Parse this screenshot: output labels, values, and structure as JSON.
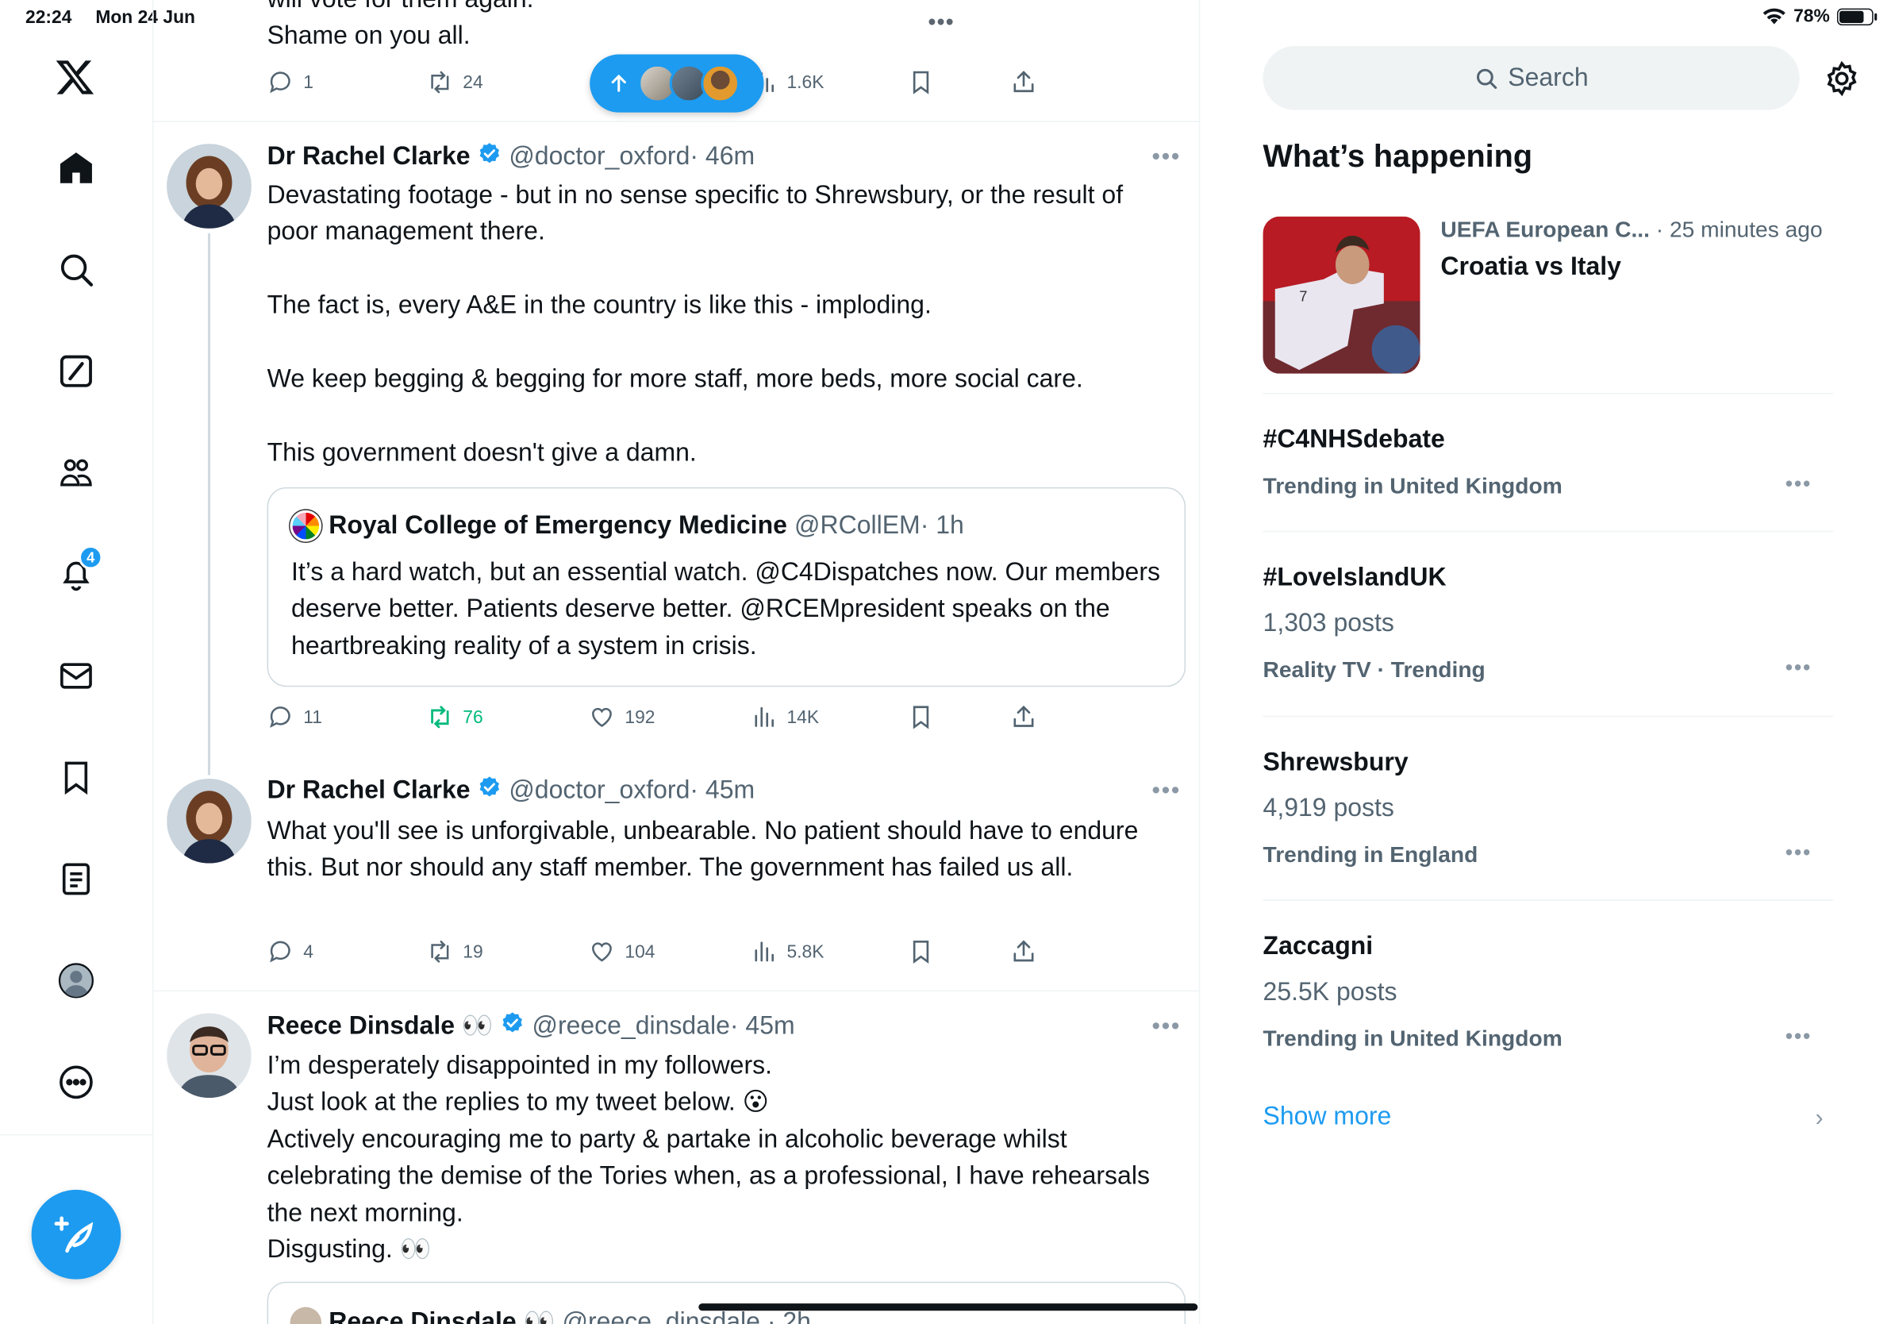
{
  "status_bar": {
    "time": "22:24",
    "date": "Mon 24 Jun",
    "battery": "78%",
    "battery_level": 0.78
  },
  "nav": {
    "items": [
      "x-logo",
      "home",
      "explore",
      "grok",
      "communities",
      "notifications",
      "messages",
      "bookmarks",
      "lists",
      "profile",
      "more"
    ],
    "notifications_badge": "4"
  },
  "feed": {
    "top_tweet": {
      "body_partial": "will vote for them again.\nShame on you all.",
      "replies": "1",
      "reposts": "24",
      "views": "1.6K"
    },
    "tweets": [
      {
        "name": "Dr Rachel Clarke",
        "handle": "@doctor_oxford",
        "time": "· 46m",
        "body": "Devastating footage - but in no sense specific to Shrewsbury, or the result of poor management there.\n\nThe fact is, every A&E in the country is like this - imploding.\n\nWe keep begging & begging for more staff, more beds, more social care.\n\nThis government doesn't give a damn.",
        "quote": {
          "name": "Royal College of Emergency Medicine",
          "handle": "@RCollEM",
          "time": "· 1h",
          "body": "It’s a hard watch, but an essential watch. @C4Dispatches now. Our members deserve better. Patients deserve better. @RCEMpresident speaks on the heartbreaking reality of a system in crisis."
        },
        "replies": "11",
        "reposts": "76",
        "likes": "192",
        "views": "14K"
      },
      {
        "name": "Dr Rachel Clarke",
        "handle": "@doctor_oxford",
        "time": "· 45m",
        "body": "What you'll see is unforgivable, unbearable. No patient should have to endure this. But nor should any staff member. The government has failed us all.",
        "replies": "4",
        "reposts": "19",
        "likes": "104",
        "views": "5.8K"
      },
      {
        "name": "Reece Dinsdale 👀",
        "handle": "@reece_dinsdale",
        "time": "· 45m",
        "body": "I’m desperately disappointed in my followers.\nJust look at the replies to my tweet below. 😮\nActively encouraging me to party & partake in alcoholic beverage whilst celebrating the demise of the Tories when, as a professional, I have rehearsals the next morning.\nDisgusting. 👀",
        "quote_name_partial": "Reece Dinsdale 👀",
        "quote_handle_partial": "@reece_dinsdale · 2h"
      }
    ]
  },
  "right": {
    "search_placeholder": "Search",
    "section_title": "What’s happening",
    "news": {
      "source": "UEFA European C...",
      "time": " · 25 minutes ago",
      "title": "Croatia vs Italy"
    },
    "trends": [
      {
        "name": "#C4NHSdebate",
        "count": "",
        "context": "Trending in United Kingdom"
      },
      {
        "name": "#LoveIslandUK",
        "count": "1,303 posts",
        "context": "Reality TV · Trending"
      },
      {
        "name": "Shrewsbury",
        "count": "4,919 posts",
        "context": "Trending in England"
      },
      {
        "name": "Zaccagni",
        "count": "25.5K posts",
        "context": "Trending in United Kingdom"
      }
    ],
    "show_more": "Show more"
  },
  "colors": {
    "accent": "#1d9bf0",
    "repost_active": "#00ba7c",
    "text": "#0f1419",
    "muted": "#536471"
  }
}
